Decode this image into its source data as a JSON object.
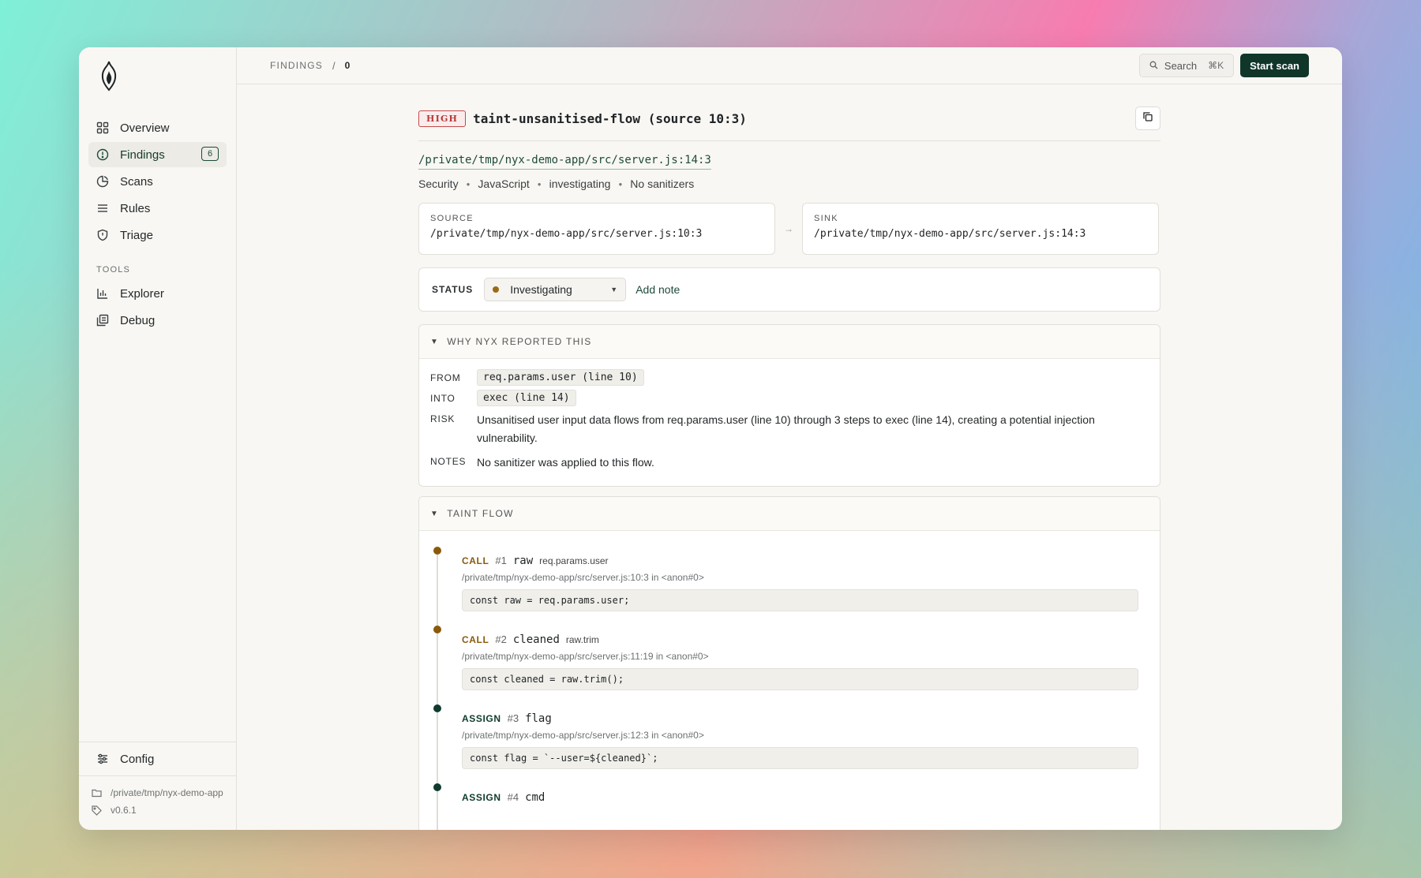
{
  "colors": {
    "accent": "#10362a",
    "call": "#8a5a0b",
    "assign": "#0f3b2e",
    "high": "#b43a3a",
    "status_dot": "#9a6a14"
  },
  "sidebar": {
    "logo_icon": "flame-shield-icon",
    "items": [
      {
        "label": "Overview",
        "icon": "grid-icon"
      },
      {
        "label": "Findings",
        "icon": "shield-alert-icon",
        "badge": "6"
      },
      {
        "label": "Scans",
        "icon": "pie-icon"
      },
      {
        "label": "Rules",
        "icon": "list-icon"
      },
      {
        "label": "Triage",
        "icon": "shield-icon"
      }
    ],
    "tools_heading": "TOOLS",
    "tools": [
      {
        "label": "Explorer",
        "icon": "chart-icon"
      },
      {
        "label": "Debug",
        "icon": "copy-stack-icon"
      }
    ],
    "config_label": "Config",
    "project_path": "/private/tmp/nyx-demo-app",
    "version": "v0.6.1"
  },
  "topbar": {
    "crumb": "FINDINGS",
    "crumb_sep": "/",
    "crumb_current": "0",
    "search_label": "Search",
    "search_shortcut": "⌘K",
    "start_scan": "Start scan"
  },
  "finding": {
    "severity": "HIGH",
    "title": "taint-unsanitised-flow (source 10:3)",
    "path": "/private/tmp/nyx-demo-app/src/server.js:14:3",
    "tags": [
      "Security",
      "JavaScript",
      "investigating",
      "No sanitizers"
    ],
    "source_label": "SOURCE",
    "source": "/private/tmp/nyx-demo-app/src/server.js:10:3",
    "arrow": "→",
    "sink_label": "SINK",
    "sink": "/private/tmp/nyx-demo-app/src/server.js:14:3",
    "status_label": "STATUS",
    "status_value": "Investigating",
    "add_note": "Add note"
  },
  "why": {
    "heading": "WHY NYX REPORTED THIS",
    "from_key": "FROM",
    "from": "req.params.user (line 10)",
    "into_key": "INTO",
    "into": "exec (line 14)",
    "risk_key": "RISK",
    "risk": "Unsanitised user input data flows from req.params.user (line 10) through 3 steps to exec (line 14), creating a potential injection vulnerability.",
    "notes_key": "NOTES",
    "notes": "No sanitizer was applied to this flow."
  },
  "flow": {
    "heading": "TAINT FLOW",
    "steps": [
      {
        "kind": "CALL",
        "num": "#1",
        "var": "raw",
        "expr": "req.params.user",
        "loc": "/private/tmp/nyx-demo-app/src/server.js:10:3 in <anon#0>",
        "code": "const raw = req.params.user;"
      },
      {
        "kind": "CALL",
        "num": "#2",
        "var": "cleaned",
        "expr": "raw.trim",
        "loc": "/private/tmp/nyx-demo-app/src/server.js:11:19 in <anon#0>",
        "code": "const cleaned = raw.trim();"
      },
      {
        "kind": "ASSIGN",
        "num": "#3",
        "var": "flag",
        "expr": "",
        "loc": "/private/tmp/nyx-demo-app/src/server.js:12:3 in <anon#0>",
        "code": "const flag = `--user=${cleaned}`;"
      },
      {
        "kind": "ASSIGN",
        "num": "#4",
        "var": "cmd",
        "expr": "",
        "loc": "",
        "code": ""
      }
    ]
  }
}
